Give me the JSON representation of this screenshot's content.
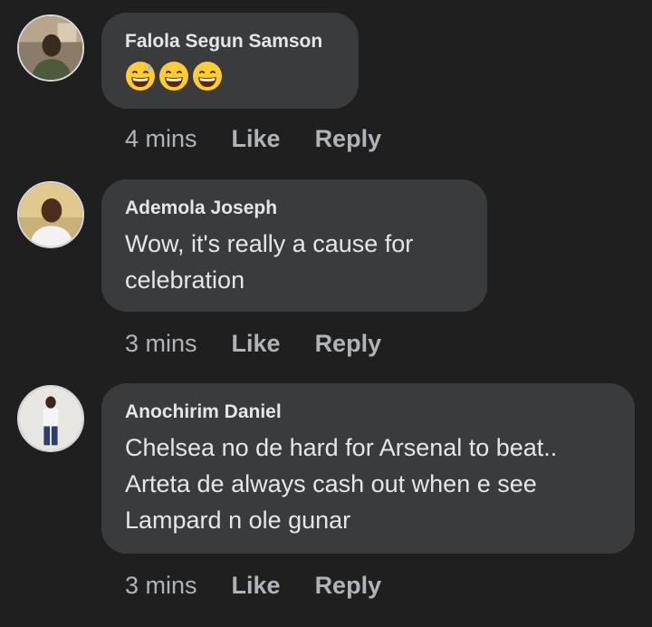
{
  "comments": [
    {
      "author": "Falola Segun Samson",
      "text": "",
      "emojis": [
        "grinning-sweat-emoji",
        "grinning-squint-emoji",
        "grinning-squint-emoji"
      ],
      "time": "4 mins",
      "like": "Like",
      "reply": "Reply"
    },
    {
      "author": "Ademola Joseph",
      "text": "Wow, it's really a cause for celebration",
      "time": "3 mins",
      "like": "Like",
      "reply": "Reply"
    },
    {
      "author": "Anochirim Daniel",
      "text": "Chelsea no de hard for Arsenal to beat.. Arteta de always cash out when e see Lampard n ole gunar",
      "time": "3 mins",
      "like": "Like",
      "reply": "Reply"
    }
  ],
  "colors": {
    "background": "#1f1f20",
    "bubble": "#3a3b3c",
    "primary_text": "#e4e6eb",
    "secondary_text": "#b0b3b8"
  }
}
